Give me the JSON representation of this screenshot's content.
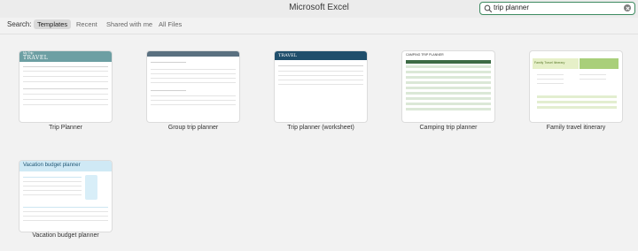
{
  "window": {
    "title": "Microsoft Excel"
  },
  "search": {
    "value": "trip planner"
  },
  "filters": {
    "label": "Search:",
    "items": [
      {
        "label": "Templates",
        "active": true
      },
      {
        "label": "Recent"
      },
      {
        "label": "Shared with me"
      },
      {
        "label": "All Files"
      }
    ]
  },
  "templates": [
    {
      "name": "Trip Planner",
      "thumb_title": "TRAVEL",
      "thumb_brand": "My Trip"
    },
    {
      "name": "Group trip planner"
    },
    {
      "name": "Trip planner (worksheet)",
      "thumb_title": "TRAVEL"
    },
    {
      "name": "Camping trip planner",
      "thumb_title": "CAMPING TRIP PLANNER"
    },
    {
      "name": "Family travel itinerary",
      "thumb_title": "Family Travel Itinerary"
    },
    {
      "name": "Vacation budget planner",
      "thumb_title": "Vacation budget planner"
    }
  ],
  "colors": {
    "accent_green": "#3d8a60",
    "teal": "#6d9fa3",
    "navy": "#1f4e6b",
    "camp_green": "#3d6b45",
    "light_blue": "#cfe9f5"
  }
}
